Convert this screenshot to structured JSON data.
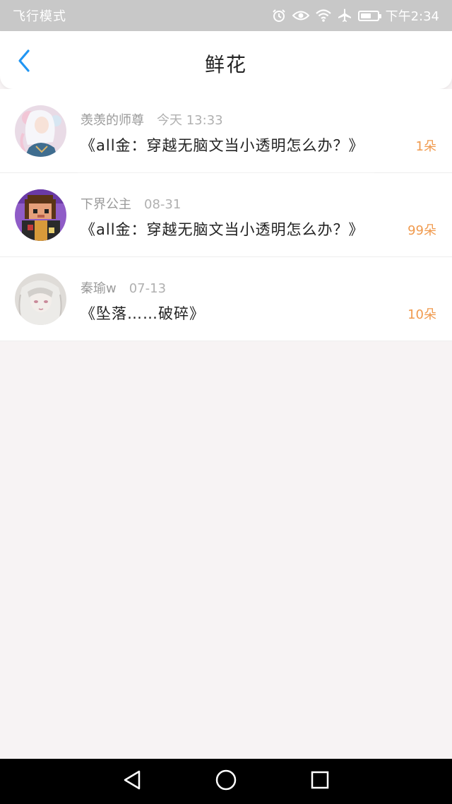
{
  "status_bar": {
    "left_text": "飞行模式",
    "time": "下午2:34",
    "battery_level": 0.65,
    "icons": [
      "alarm-icon",
      "eye-icon",
      "wifi-icon",
      "airplane-icon",
      "battery-icon"
    ]
  },
  "header": {
    "title": "鲜花",
    "back_icon": "chevron-left-icon",
    "accent_color": "#2196f3"
  },
  "items": [
    {
      "username": "羡羡的师尊",
      "time": "今天 13:33",
      "content": "《all金：穿越无脑文当小透明怎么办？》",
      "count": "1朵",
      "avatar": "anime-avatar-white-hair"
    },
    {
      "username": "下界公主",
      "time": "08-31",
      "content": "《all金：穿越无脑文当小透明怎么办？》",
      "count": "99朵",
      "avatar": "pixel-avatar-minecraft"
    },
    {
      "username": "秦瑜w",
      "time": "07-13",
      "content": "《坠落……破碎》",
      "count": "10朵",
      "avatar": "sketch-avatar-girl"
    }
  ],
  "count_color": "#f09a4e",
  "nav": {
    "back_icon": "triangle-back-icon",
    "home_icon": "circle-home-icon",
    "recents_icon": "square-recents-icon"
  }
}
